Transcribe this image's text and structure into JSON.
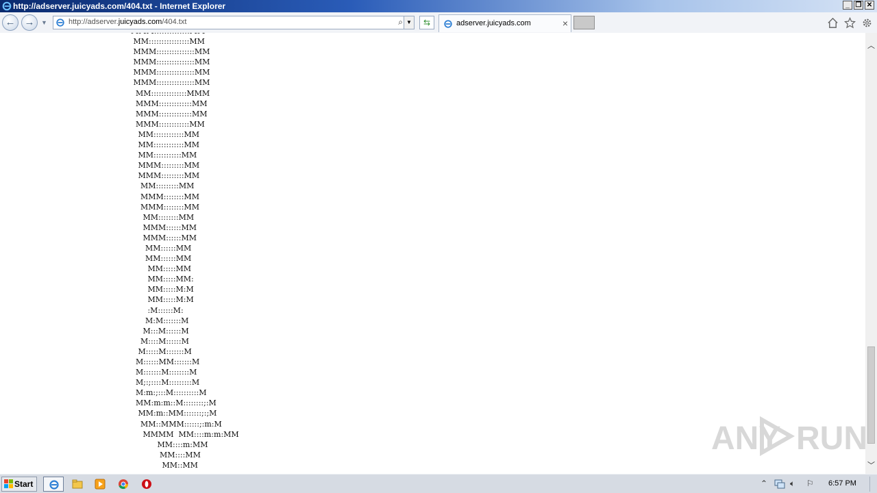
{
  "window": {
    "title": "http://adserver.juicyads.com/404.txt - Internet Explorer",
    "controls": [
      "minimize",
      "restore",
      "close"
    ]
  },
  "navbar": {
    "address_scheme": "http://adserver.",
    "address_host": "juicyads.com",
    "address_path": "/404.txt",
    "tab_title": "adserver.juicyads.com",
    "icons": [
      "back-icon",
      "forward-icon",
      "search-icon",
      "refresh-icon",
      "home-icon",
      "favorites-star-icon",
      "tools-gear-icon"
    ]
  },
  "content": {
    "ascii_art": "MMM::::::::::::::MM\n MM::::::::::::::::MM\n MMM:::::::::::::::MM\n MMM:::::::::::::::MM\n MMM:::::::::::::::MM\n MMM:::::::::::::::MM\n  MM::::::::::::::MMM\n  MMM:::::::::::::MM\n  MMM:::::::::::::MM\n  MMM::::::::::::MM\n   MM::::::::::::MM\n   MM::::::::::::MM\n   MM:::::::::::MM\n   MMM:::::::::MM\n   MMM:::::::::MM\n    MM:::::::::MM\n    MMM::::::::MM\n    MMM::::::::MM\n     MM::::::::MM\n     MMM::::::MM\n     MMM::::::MM\n      MM::::::MM\n      MM::::::MM\n       MM:::::MM\n       MM:::::MM:\n       MM:::::M:M\n       MM:::::M:M\n       :M::::::M:\n      M:M:::::::M\n     M:::M::::::M\n    M::::M::::::M\n   M:::::M:::::::M\n  M::::::MM:::::::M\n  M:::::::M::::::::M\n  M;:;::::M:::::::::M\n  M:m:;:::M::::::::::M\n  MM:m:m::M::::::::;:M\n   MM:m::MM:::::::;:;M\n    MM::MMM::::::;:m:M\n     MMMM  MM::::m:m:MM\n           MM::::m:MM\n            MM::::MM\n             MM::MM"
  },
  "watermark": {
    "text_left": "ANY",
    "text_right": "RUN"
  },
  "taskbar": {
    "start_label": "Start",
    "apps": [
      "internet-explorer-icon",
      "file-explorer-icon",
      "media-player-icon",
      "chrome-icon",
      "opera-icon"
    ],
    "tray_icons": [
      "show-hidden-icons-arrow",
      "network-icon",
      "volume-icon",
      "action-center-flag-icon"
    ],
    "clock": "6:57 PM"
  }
}
